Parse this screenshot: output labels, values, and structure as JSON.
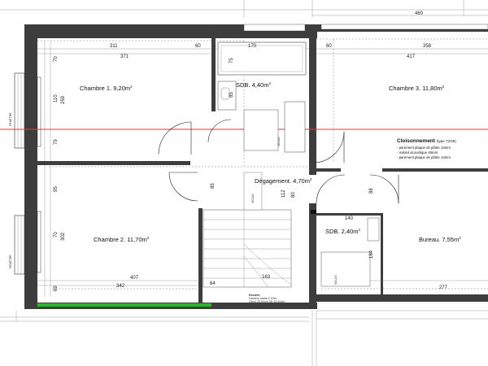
{
  "rooms": {
    "chambre1": {
      "name": "Chambre 1.",
      "area": "9,20m",
      "sup": "2"
    },
    "sdb1": {
      "name": "SDB.",
      "area": "4,40m",
      "sup": "2"
    },
    "chambre3": {
      "name": "Chambre 3.",
      "area": "11,80m",
      "sup": "2"
    },
    "degagement": {
      "name": "Dégagement.",
      "area": "4,70m",
      "sup": "2"
    },
    "chambre2": {
      "name": "Chambre 2.",
      "area": "11,70m",
      "sup": "2"
    },
    "sdb2": {
      "name": "SDB.",
      "area": "2,40m",
      "sup": "2"
    },
    "bureau": {
      "name": "Bureau.",
      "area": "7,55m",
      "sup": "2"
    }
  },
  "legend": {
    "title": "Cloisonnement",
    "type": "(type 72/48)",
    "lines": [
      "- parement plaque de plâtre 13mm",
      "- isolant acoustique 45mm",
      "- parement plaque de plâtre 13mm"
    ]
  },
  "dims": {
    "top_right": "460",
    "c1_top_a": "311",
    "c1_top_b": "371",
    "sdb_top_a": "60",
    "sdb_top_b": "170",
    "sdb_side": "75",
    "sdb_inner": "85",
    "c1_left_a": "70",
    "c1_left_b": "259",
    "c1_left_c": "110",
    "c1_left_d": "79",
    "c3_top_a": "60",
    "c3_top_b": "417",
    "c3_top_c": "358",
    "c2_left_a": "95",
    "c2_left_b": "302",
    "c2_left_c": "70",
    "c2_left_d": "69",
    "c2_bottom_a": "407",
    "c2_bottom_b": "342",
    "c2_bottom_c": "64",
    "deg_a": "85",
    "deg_b": "112",
    "deg_c": "80",
    "deg_d": "88",
    "sdb2_top": "140",
    "sdb2_side": "184",
    "bureau_bottom": "277",
    "stair": "163"
  },
  "window_labels": {
    "left_top": "FENÊTRE",
    "left_bottom": "FENÊTRE"
  },
  "stairs": {
    "title": "Escalier",
    "line1": "Hauteur totale 2,XXm",
    "line2": "Giron 25,5Xcm Nb 16,40cm",
    "label": "VELUX"
  },
  "colors": {
    "wall": "#3d3d3d",
    "green_marker": "#1fbf1f",
    "red_line": "#e53a3a"
  }
}
